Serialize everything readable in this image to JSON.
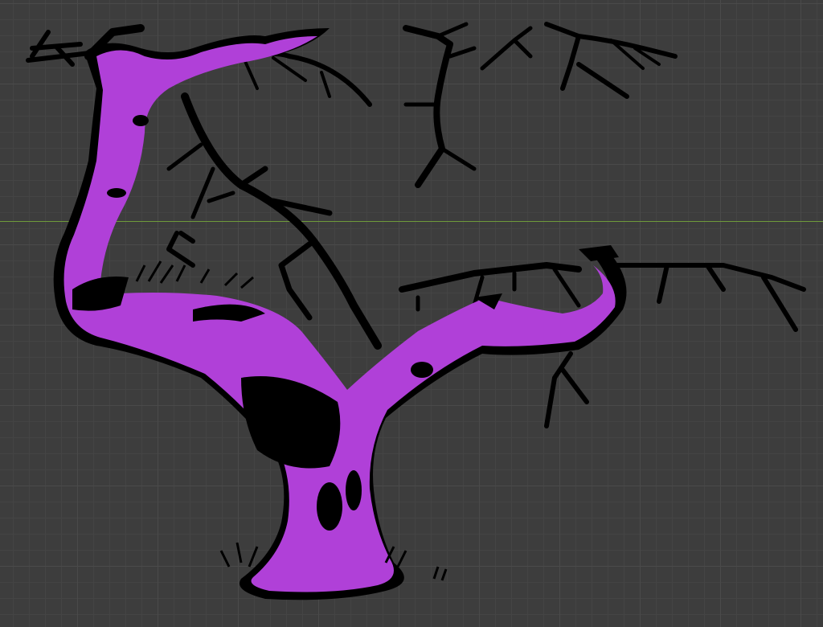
{
  "viewport": {
    "background": "#3d3d3d",
    "grid_color": "#4a4a4a",
    "axis_color": "#6f9a3a"
  },
  "artwork": {
    "subject": "tree-illustration",
    "fill_color": "#b040d8",
    "ink_color": "#000000"
  }
}
